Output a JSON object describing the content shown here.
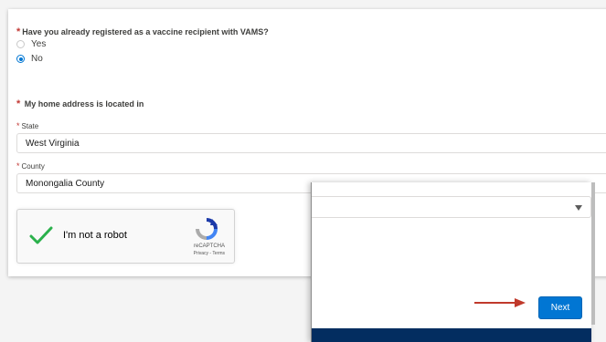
{
  "form": {
    "required_marker": "*",
    "question": "Have you already registered as a vaccine recipient with VAMS?",
    "options": [
      {
        "label": "Yes",
        "selected": false
      },
      {
        "label": "No",
        "selected": true
      }
    ],
    "home_address_label": "My home address is located in",
    "state": {
      "label": "State",
      "value": "West Virginia"
    },
    "county": {
      "label": "County",
      "value": "Monongalia County"
    }
  },
  "recaptcha": {
    "label": "I'm not a robot",
    "checked": true,
    "brand": "reCAPTCHA",
    "links": "Privacy - Terms"
  },
  "overlay": {
    "next_label": "Next",
    "footer_color": "#032d60"
  },
  "colors": {
    "accent": "#0176d3",
    "required": "#c23934",
    "check": "#2bb14c",
    "annotation_arrow": "#c0392b"
  },
  "icons": [
    "checkmark-icon",
    "recaptcha-logo-icon",
    "chevron-down-icon",
    "red-arrow-annotation-icon"
  ]
}
